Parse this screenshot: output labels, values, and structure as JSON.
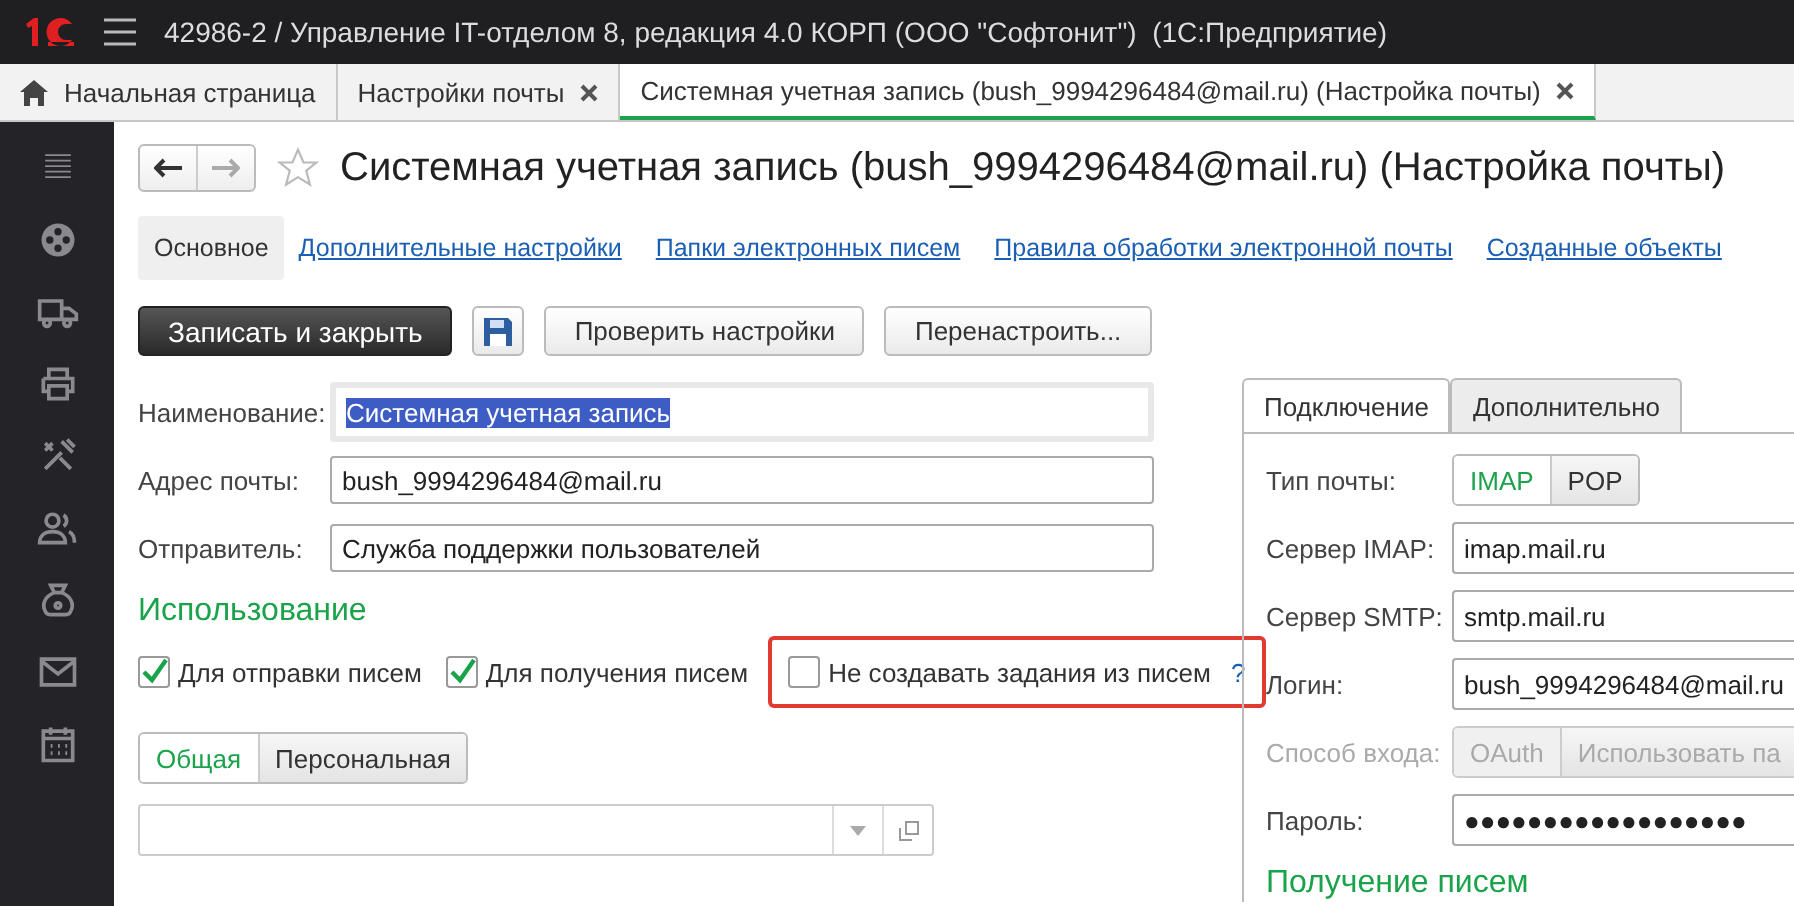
{
  "window": {
    "title": "42986-2 / Управление IT-отделом 8, редакция 4.0 КОРП (ООО \"Софтонит\")  (1С:Предприятие)"
  },
  "tabs": [
    {
      "label": "Начальная страница",
      "kind": "home",
      "selected": false
    },
    {
      "label": "Настройки почты",
      "kind": "closable",
      "selected": false
    },
    {
      "label": "Системная учетная запись (bush_9994296484@mail.ru) (Настройка почты)",
      "kind": "closable",
      "selected": true
    }
  ],
  "form": {
    "title": "Системная учетная запись (bush_9994296484@mail.ru) (Настройка почты)",
    "sections": [
      {
        "label": "Основное",
        "selected": true
      },
      {
        "label": "Дополнительные настройки",
        "selected": false
      },
      {
        "label": "Папки электронных писем",
        "selected": false
      },
      {
        "label": "Правила обработки электронной почты",
        "selected": false
      },
      {
        "label": "Созданные объекты",
        "selected": false
      }
    ],
    "commands": [
      {
        "kind": "primary",
        "label": "Записать и закрыть"
      },
      {
        "kind": "save"
      },
      {
        "kind": "default",
        "label": "Проверить настройки"
      },
      {
        "kind": "default",
        "label": "Перенастроить..."
      }
    ],
    "fields": [
      {
        "label": "Наименование:",
        "value": "Системная учетная запись",
        "text_selected": true
      },
      {
        "label": "Адрес почты:",
        "value": "bush_9994296484@mail.ru",
        "text_selected": false
      },
      {
        "label": "Отправитель:",
        "value": "Служба поддержки пользователей",
        "text_selected": false
      }
    ],
    "usage": {
      "heading": "Использование",
      "checkboxes": [
        {
          "label": "Для отправки писем",
          "checked": true,
          "outlined": false
        },
        {
          "label": "Для получения писем",
          "checked": true,
          "outlined": false
        },
        {
          "label": "Не создавать задания из писем",
          "checked": false,
          "outlined": true,
          "help": "?"
        }
      ]
    },
    "access_tabs": [
      {
        "label": "Общая",
        "selected": true
      },
      {
        "label": "Персональная",
        "selected": false
      }
    ],
    "connection": {
      "tabs": [
        {
          "label": "Подключение",
          "selected": true
        },
        {
          "label": "Дополнительно",
          "selected": false
        }
      ],
      "rows": [
        {
          "kind": "toggle",
          "label": "Тип почты:",
          "disabled": false,
          "options": [
            {
              "label": "IMAP",
              "selected": true
            },
            {
              "label": "POP",
              "selected": false
            }
          ]
        },
        {
          "kind": "field",
          "label": "Сервер IMAP:",
          "disabled": false,
          "value": "imap.mail.ru"
        },
        {
          "kind": "field",
          "label": "Сервер SMTP:",
          "disabled": false,
          "value": "smtp.mail.ru"
        },
        {
          "kind": "field",
          "label": "Логин:",
          "disabled": false,
          "value": "bush_9994296484@mail.ru"
        },
        {
          "kind": "toggle",
          "label": "Способ входа:",
          "disabled": true,
          "options": [
            {
              "label": "OAuth",
              "selected": true
            },
            {
              "label": "Использовать па",
              "selected": false
            }
          ]
        },
        {
          "kind": "field",
          "label": "Пароль:",
          "disabled": false,
          "value": "●●●●●●●●●●●●●●●●●●"
        }
      ],
      "heading": "Получение писем"
    }
  }
}
